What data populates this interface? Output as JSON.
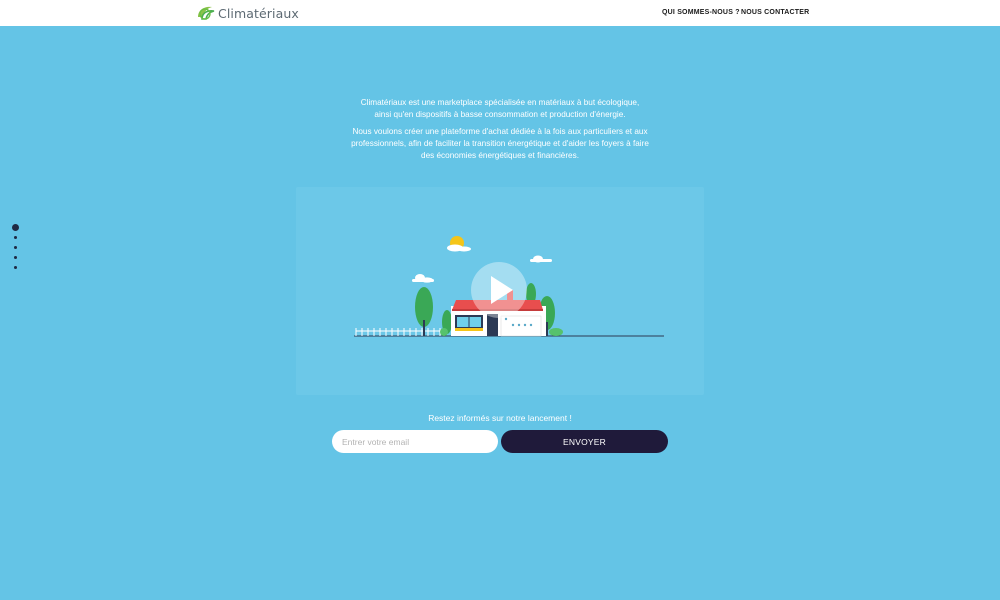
{
  "header": {
    "logo_text": "Climatériaux",
    "nav": [
      {
        "label": "QUI SOMMES-NOUS ?"
      },
      {
        "label": "NOUS CONTACTER"
      }
    ]
  },
  "section_nav": {
    "count": 5,
    "active_index": 0
  },
  "intro": {
    "paragraph1_line1": "Climatériaux est une marketplace spécialisée en matériaux à but écologique,",
    "paragraph1_line2": "ainsi qu'en dispositifs à basse consommation et production d'énergie.",
    "paragraph2_line1": "Nous voulons créer une plateforme d'achat dédiée à la fois aux particuliers et aux",
    "paragraph2_line2": "professionnels, afin de faciliter la transition énergétique et d'aider les foyers à faire",
    "paragraph2_line3": "des économies énergétiques et financières."
  },
  "video": {
    "play_icon": "play-icon"
  },
  "newsletter": {
    "title": "Restez informés sur notre lancement !",
    "email_placeholder": "Entrer votre email",
    "email_value": "",
    "submit_label": "ENVOYER"
  },
  "colors": {
    "background": "#64c4e6",
    "button": "#1f1a3a",
    "logo_green": "#8bc34a",
    "roof": "#e84e4e"
  }
}
